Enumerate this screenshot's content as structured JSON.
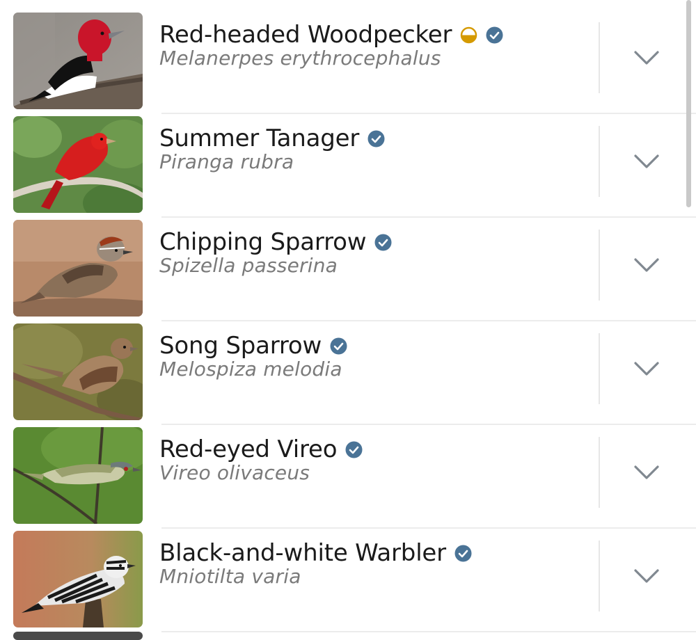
{
  "colors": {
    "verified_badge": "#4a7396",
    "partial_badge": "#d59a00",
    "chevron": "#808890",
    "common_name": "#1a1a1a",
    "scientific_name": "#7a7a7a"
  },
  "birds": [
    {
      "common_name": "Red-headed Woodpecker",
      "scientific_name": "Melanerpes erythrocephalus",
      "badges": [
        "half-circle-icon",
        "verified-check-icon"
      ]
    },
    {
      "common_name": "Summer Tanager",
      "scientific_name": "Piranga rubra",
      "badges": [
        "verified-check-icon"
      ]
    },
    {
      "common_name": "Chipping Sparrow",
      "scientific_name": "Spizella passerina",
      "badges": [
        "verified-check-icon"
      ]
    },
    {
      "common_name": "Song Sparrow",
      "scientific_name": "Melospiza melodia",
      "badges": [
        "verified-check-icon"
      ]
    },
    {
      "common_name": "Red-eyed Vireo",
      "scientific_name": "Vireo olivaceus",
      "badges": [
        "verified-check-icon"
      ]
    },
    {
      "common_name": "Black-and-white Warbler",
      "scientific_name": "Mniotilta varia",
      "badges": [
        "verified-check-icon"
      ]
    }
  ],
  "expand_icon": "chevron-down-icon"
}
